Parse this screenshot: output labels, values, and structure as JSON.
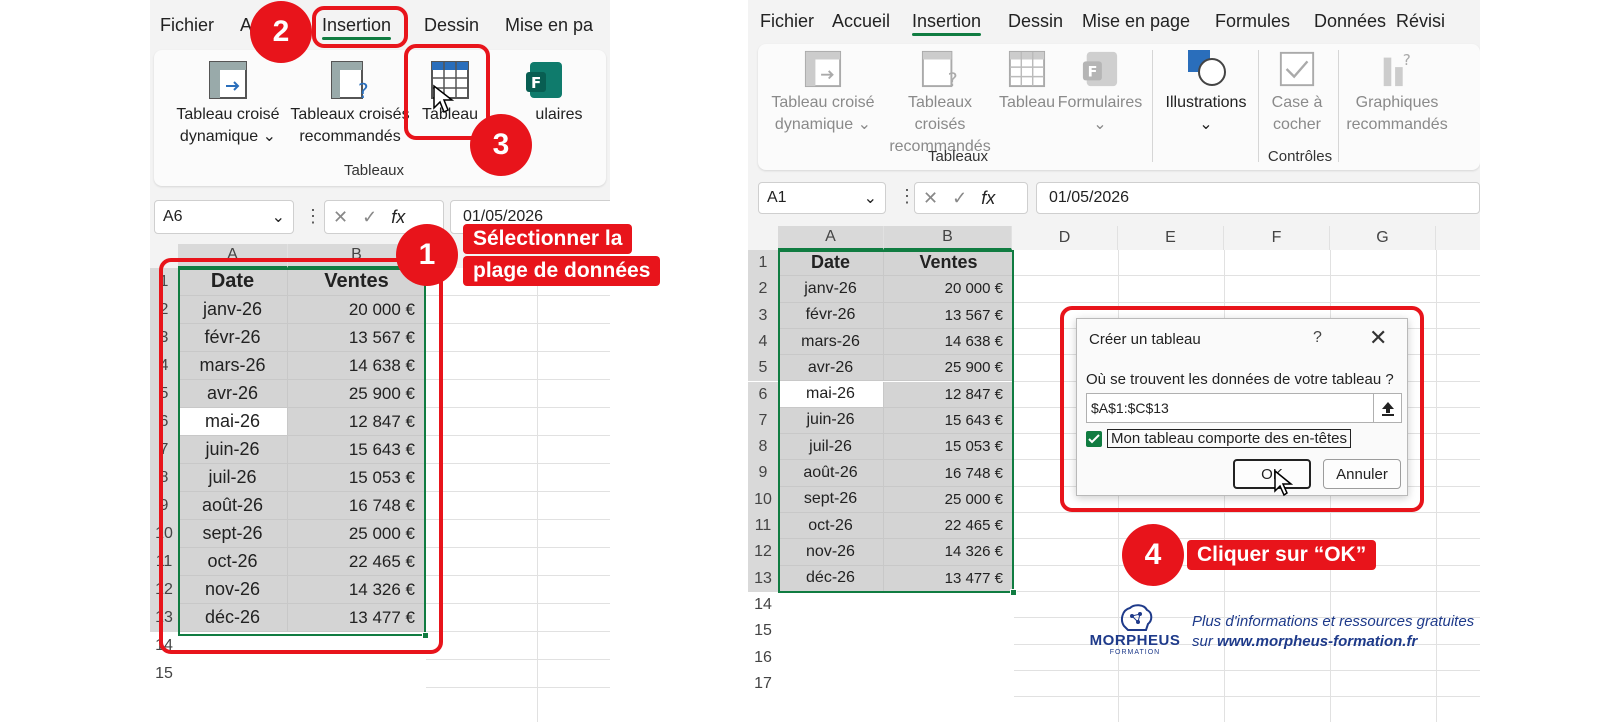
{
  "left": {
    "menu": [
      "Fichier",
      "A",
      "Insertion",
      "Dessin",
      "Mise en pa"
    ],
    "ribbon": {
      "btn_pivot": "Tableau croisé",
      "btn_pivot_2": "dynamique",
      "btn_recommended": "Tableaux croisés",
      "btn_recommended_2": "recommandés",
      "btn_table": "Tableau",
      "btn_forms": "ulaires",
      "group": "Tableaux"
    },
    "name_box": "A6",
    "formula_value": "01/05/2026",
    "columns": [
      "A",
      "B"
    ],
    "rows": [
      "1",
      "2",
      "3",
      "4",
      "5",
      "6",
      "7",
      "8",
      "9",
      "10",
      "11",
      "12",
      "13",
      "14",
      "15"
    ]
  },
  "right": {
    "menu": [
      "Fichier",
      "Accueil",
      "Insertion",
      "Dessin",
      "Mise en page",
      "Formules",
      "Données",
      "Révisi"
    ],
    "ribbon": {
      "btn_pivot": "Tableau croisé",
      "btn_pivot_2": "dynamique",
      "btn_recommended": "Tableaux croisés",
      "btn_recommended_2": "recommandés",
      "btn_table": "Tableau",
      "btn_forms": "Formulaires",
      "btn_illustrations": "Illustrations",
      "btn_checkbox": "Case à",
      "btn_checkbox_2": "cocher",
      "btn_charts": "Graphiques",
      "btn_charts_2": "recommandés",
      "group_tables": "Tableaux",
      "group_controls": "Contrôles"
    },
    "name_box": "A1",
    "formula_value": "01/05/2026",
    "columns": [
      "A",
      "B",
      "D",
      "E",
      "F",
      "G"
    ],
    "rows": [
      "1",
      "2",
      "3",
      "4",
      "5",
      "6",
      "7",
      "8",
      "9",
      "10",
      "11",
      "12",
      "13",
      "14",
      "15",
      "16",
      "17"
    ]
  },
  "table": {
    "headers": [
      "Date",
      "Ventes"
    ],
    "rows": [
      [
        "janv-26",
        "20 000 €"
      ],
      [
        "févr-26",
        "13 567 €"
      ],
      [
        "mars-26",
        "14 638 €"
      ],
      [
        "avr-26",
        "25 900 €"
      ],
      [
        "mai-26",
        "12 847 €"
      ],
      [
        "juin-26",
        "15 643 €"
      ],
      [
        "juil-26",
        "15 053 €"
      ],
      [
        "août-26",
        "16 748 €"
      ],
      [
        "sept-26",
        "25 000 €"
      ],
      [
        "oct-26",
        "22 465 €"
      ],
      [
        "nov-26",
        "14 326 €"
      ],
      [
        "déc-26",
        "13 477 €"
      ]
    ]
  },
  "dialog": {
    "title": "Créer un tableau",
    "help": "?",
    "prompt": "Où se trouvent les données de votre tableau ?",
    "range": "$A$1:$C$13",
    "checkbox_label": "Mon tableau comporte des en-têtes",
    "ok": "OK",
    "cancel": "Annuler"
  },
  "callouts": {
    "step1": "1",
    "step1_label_1": "Sélectionner la",
    "step1_label_2": "plage de données",
    "step2": "2",
    "step3": "3",
    "step4": "4",
    "step4_label": "Cliquer sur “OK”"
  },
  "footer": {
    "logo": "MORPHEUS",
    "logo_sub": "FORMATION",
    "line1": "Plus d'informations et ressources gratuites",
    "line2_prefix": "sur ",
    "line2_link": "www.morpheus-formation.fr"
  },
  "colors": {
    "accent": "#107c41",
    "callout": "#e8141b",
    "footer_text": "#1e3a8a"
  }
}
